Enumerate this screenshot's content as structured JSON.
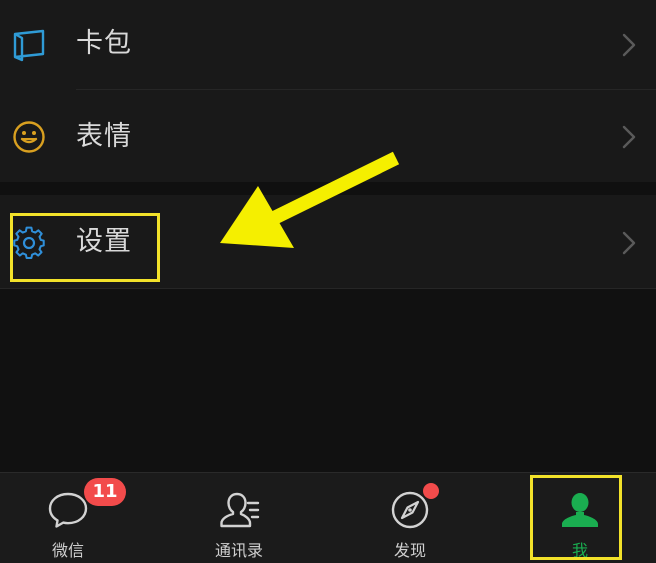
{
  "menu": {
    "items": [
      {
        "label": "卡包",
        "icon": "wallet-card-icon",
        "icon_color": "#2f9bd6"
      },
      {
        "label": "表情",
        "icon": "smiley-face-icon",
        "icon_color": "#d9a020"
      },
      {
        "label": "设置",
        "icon": "gear-icon",
        "icon_color": "#2f8fd9"
      }
    ]
  },
  "tabbar": {
    "tabs": [
      {
        "label": "微信",
        "icon": "chat-bubble-icon",
        "badge": "11"
      },
      {
        "label": "通讯录",
        "icon": "contacts-icon"
      },
      {
        "label": "发现",
        "icon": "compass-icon",
        "dot": true
      },
      {
        "label": "我",
        "icon": "person-icon",
        "active": true
      }
    ]
  },
  "annotations": {
    "highlight_color": "#f2e22a",
    "arrow_color": "#f5ef00"
  },
  "colors": {
    "background": "#111111",
    "row_background": "#191919",
    "active_tab": "#1aad50",
    "badge": "#f24b4b"
  }
}
